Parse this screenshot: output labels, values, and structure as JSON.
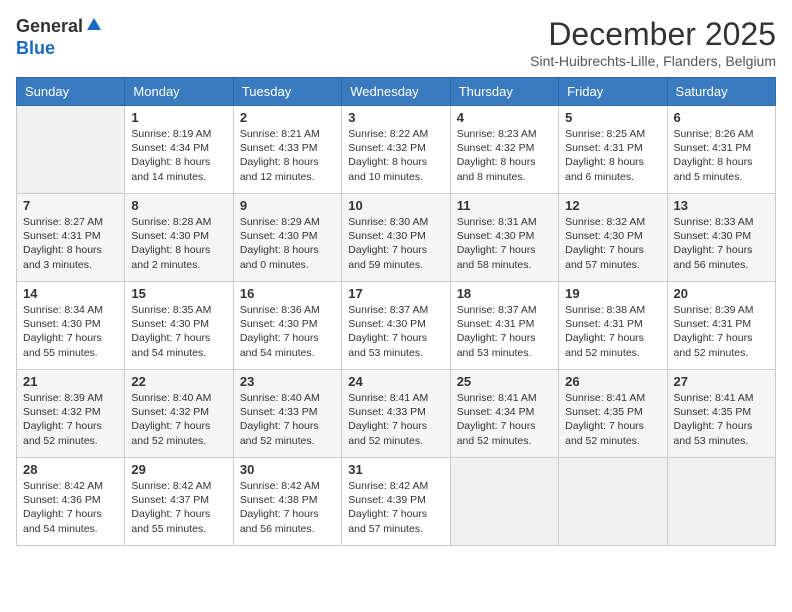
{
  "logo": {
    "line1": "General",
    "line2": "Blue"
  },
  "header": {
    "month": "December 2025",
    "location": "Sint-Huibrechts-Lille, Flanders, Belgium"
  },
  "weekdays": [
    "Sunday",
    "Monday",
    "Tuesday",
    "Wednesday",
    "Thursday",
    "Friday",
    "Saturday"
  ],
  "weeks": [
    [
      {
        "date": "",
        "info": ""
      },
      {
        "date": "1",
        "info": "Sunrise: 8:19 AM\nSunset: 4:34 PM\nDaylight: 8 hours\nand 14 minutes."
      },
      {
        "date": "2",
        "info": "Sunrise: 8:21 AM\nSunset: 4:33 PM\nDaylight: 8 hours\nand 12 minutes."
      },
      {
        "date": "3",
        "info": "Sunrise: 8:22 AM\nSunset: 4:32 PM\nDaylight: 8 hours\nand 10 minutes."
      },
      {
        "date": "4",
        "info": "Sunrise: 8:23 AM\nSunset: 4:32 PM\nDaylight: 8 hours\nand 8 minutes."
      },
      {
        "date": "5",
        "info": "Sunrise: 8:25 AM\nSunset: 4:31 PM\nDaylight: 8 hours\nand 6 minutes."
      },
      {
        "date": "6",
        "info": "Sunrise: 8:26 AM\nSunset: 4:31 PM\nDaylight: 8 hours\nand 5 minutes."
      }
    ],
    [
      {
        "date": "7",
        "info": "Sunrise: 8:27 AM\nSunset: 4:31 PM\nDaylight: 8 hours\nand 3 minutes."
      },
      {
        "date": "8",
        "info": "Sunrise: 8:28 AM\nSunset: 4:30 PM\nDaylight: 8 hours\nand 2 minutes."
      },
      {
        "date": "9",
        "info": "Sunrise: 8:29 AM\nSunset: 4:30 PM\nDaylight: 8 hours\nand 0 minutes."
      },
      {
        "date": "10",
        "info": "Sunrise: 8:30 AM\nSunset: 4:30 PM\nDaylight: 7 hours\nand 59 minutes."
      },
      {
        "date": "11",
        "info": "Sunrise: 8:31 AM\nSunset: 4:30 PM\nDaylight: 7 hours\nand 58 minutes."
      },
      {
        "date": "12",
        "info": "Sunrise: 8:32 AM\nSunset: 4:30 PM\nDaylight: 7 hours\nand 57 minutes."
      },
      {
        "date": "13",
        "info": "Sunrise: 8:33 AM\nSunset: 4:30 PM\nDaylight: 7 hours\nand 56 minutes."
      }
    ],
    [
      {
        "date": "14",
        "info": "Sunrise: 8:34 AM\nSunset: 4:30 PM\nDaylight: 7 hours\nand 55 minutes."
      },
      {
        "date": "15",
        "info": "Sunrise: 8:35 AM\nSunset: 4:30 PM\nDaylight: 7 hours\nand 54 minutes."
      },
      {
        "date": "16",
        "info": "Sunrise: 8:36 AM\nSunset: 4:30 PM\nDaylight: 7 hours\nand 54 minutes."
      },
      {
        "date": "17",
        "info": "Sunrise: 8:37 AM\nSunset: 4:30 PM\nDaylight: 7 hours\nand 53 minutes."
      },
      {
        "date": "18",
        "info": "Sunrise: 8:37 AM\nSunset: 4:31 PM\nDaylight: 7 hours\nand 53 minutes."
      },
      {
        "date": "19",
        "info": "Sunrise: 8:38 AM\nSunset: 4:31 PM\nDaylight: 7 hours\nand 52 minutes."
      },
      {
        "date": "20",
        "info": "Sunrise: 8:39 AM\nSunset: 4:31 PM\nDaylight: 7 hours\nand 52 minutes."
      }
    ],
    [
      {
        "date": "21",
        "info": "Sunrise: 8:39 AM\nSunset: 4:32 PM\nDaylight: 7 hours\nand 52 minutes."
      },
      {
        "date": "22",
        "info": "Sunrise: 8:40 AM\nSunset: 4:32 PM\nDaylight: 7 hours\nand 52 minutes."
      },
      {
        "date": "23",
        "info": "Sunrise: 8:40 AM\nSunset: 4:33 PM\nDaylight: 7 hours\nand 52 minutes."
      },
      {
        "date": "24",
        "info": "Sunrise: 8:41 AM\nSunset: 4:33 PM\nDaylight: 7 hours\nand 52 minutes."
      },
      {
        "date": "25",
        "info": "Sunrise: 8:41 AM\nSunset: 4:34 PM\nDaylight: 7 hours\nand 52 minutes."
      },
      {
        "date": "26",
        "info": "Sunrise: 8:41 AM\nSunset: 4:35 PM\nDaylight: 7 hours\nand 52 minutes."
      },
      {
        "date": "27",
        "info": "Sunrise: 8:41 AM\nSunset: 4:35 PM\nDaylight: 7 hours\nand 53 minutes."
      }
    ],
    [
      {
        "date": "28",
        "info": "Sunrise: 8:42 AM\nSunset: 4:36 PM\nDaylight: 7 hours\nand 54 minutes."
      },
      {
        "date": "29",
        "info": "Sunrise: 8:42 AM\nSunset: 4:37 PM\nDaylight: 7 hours\nand 55 minutes."
      },
      {
        "date": "30",
        "info": "Sunrise: 8:42 AM\nSunset: 4:38 PM\nDaylight: 7 hours\nand 56 minutes."
      },
      {
        "date": "31",
        "info": "Sunrise: 8:42 AM\nSunset: 4:39 PM\nDaylight: 7 hours\nand 57 minutes."
      },
      {
        "date": "",
        "info": ""
      },
      {
        "date": "",
        "info": ""
      },
      {
        "date": "",
        "info": ""
      }
    ]
  ]
}
